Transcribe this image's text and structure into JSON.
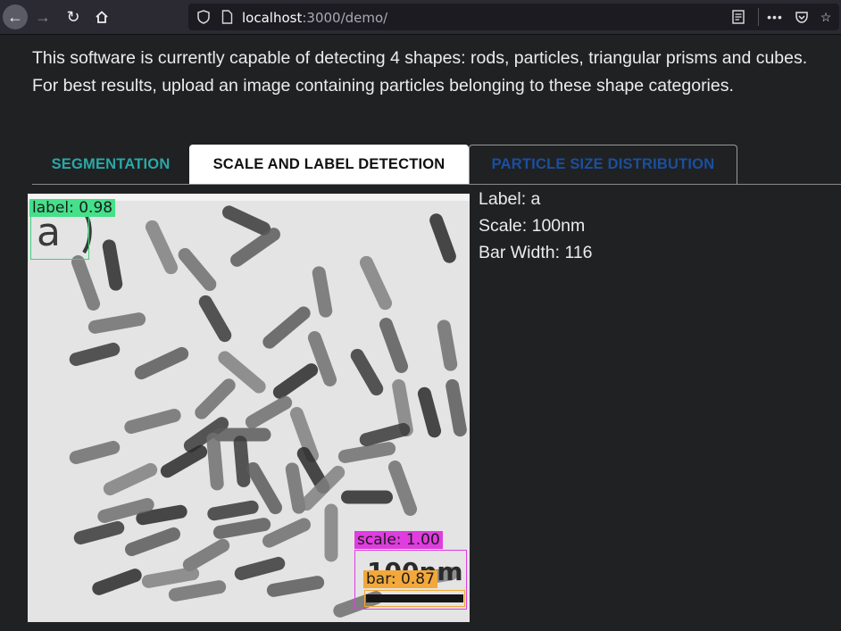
{
  "browser": {
    "url_host": "localhost",
    "url_rest": ":3000/demo/"
  },
  "intro": {
    "line1": "This software is currently capable of detecting 4 shapes: rods, particles, triangular prisms and cubes.",
    "line2": "For best results, upload an image containing particles belonging to these shape categories."
  },
  "tabs": [
    {
      "label": "SEGMENTATION",
      "color": "#2aa8a8"
    },
    {
      "label": "SCALE AND LABEL DETECTION",
      "active": true
    },
    {
      "label": "PARTICLE SIZE DISTRIBUTION",
      "color": "#1a4fa0"
    }
  ],
  "image": {
    "panel_label": "a",
    "scale_text": "100nm",
    "detections": [
      {
        "tag": "label:  0.98",
        "color": "#44e08a"
      },
      {
        "tag": "scale:  1.00",
        "color": "#e03ce0"
      },
      {
        "tag": "bar:  0.87",
        "color": "#f2a83a"
      }
    ]
  },
  "result": {
    "label": "Label: a",
    "scale": "Scale: 100nm",
    "bar_width": "Bar Width: 116"
  }
}
